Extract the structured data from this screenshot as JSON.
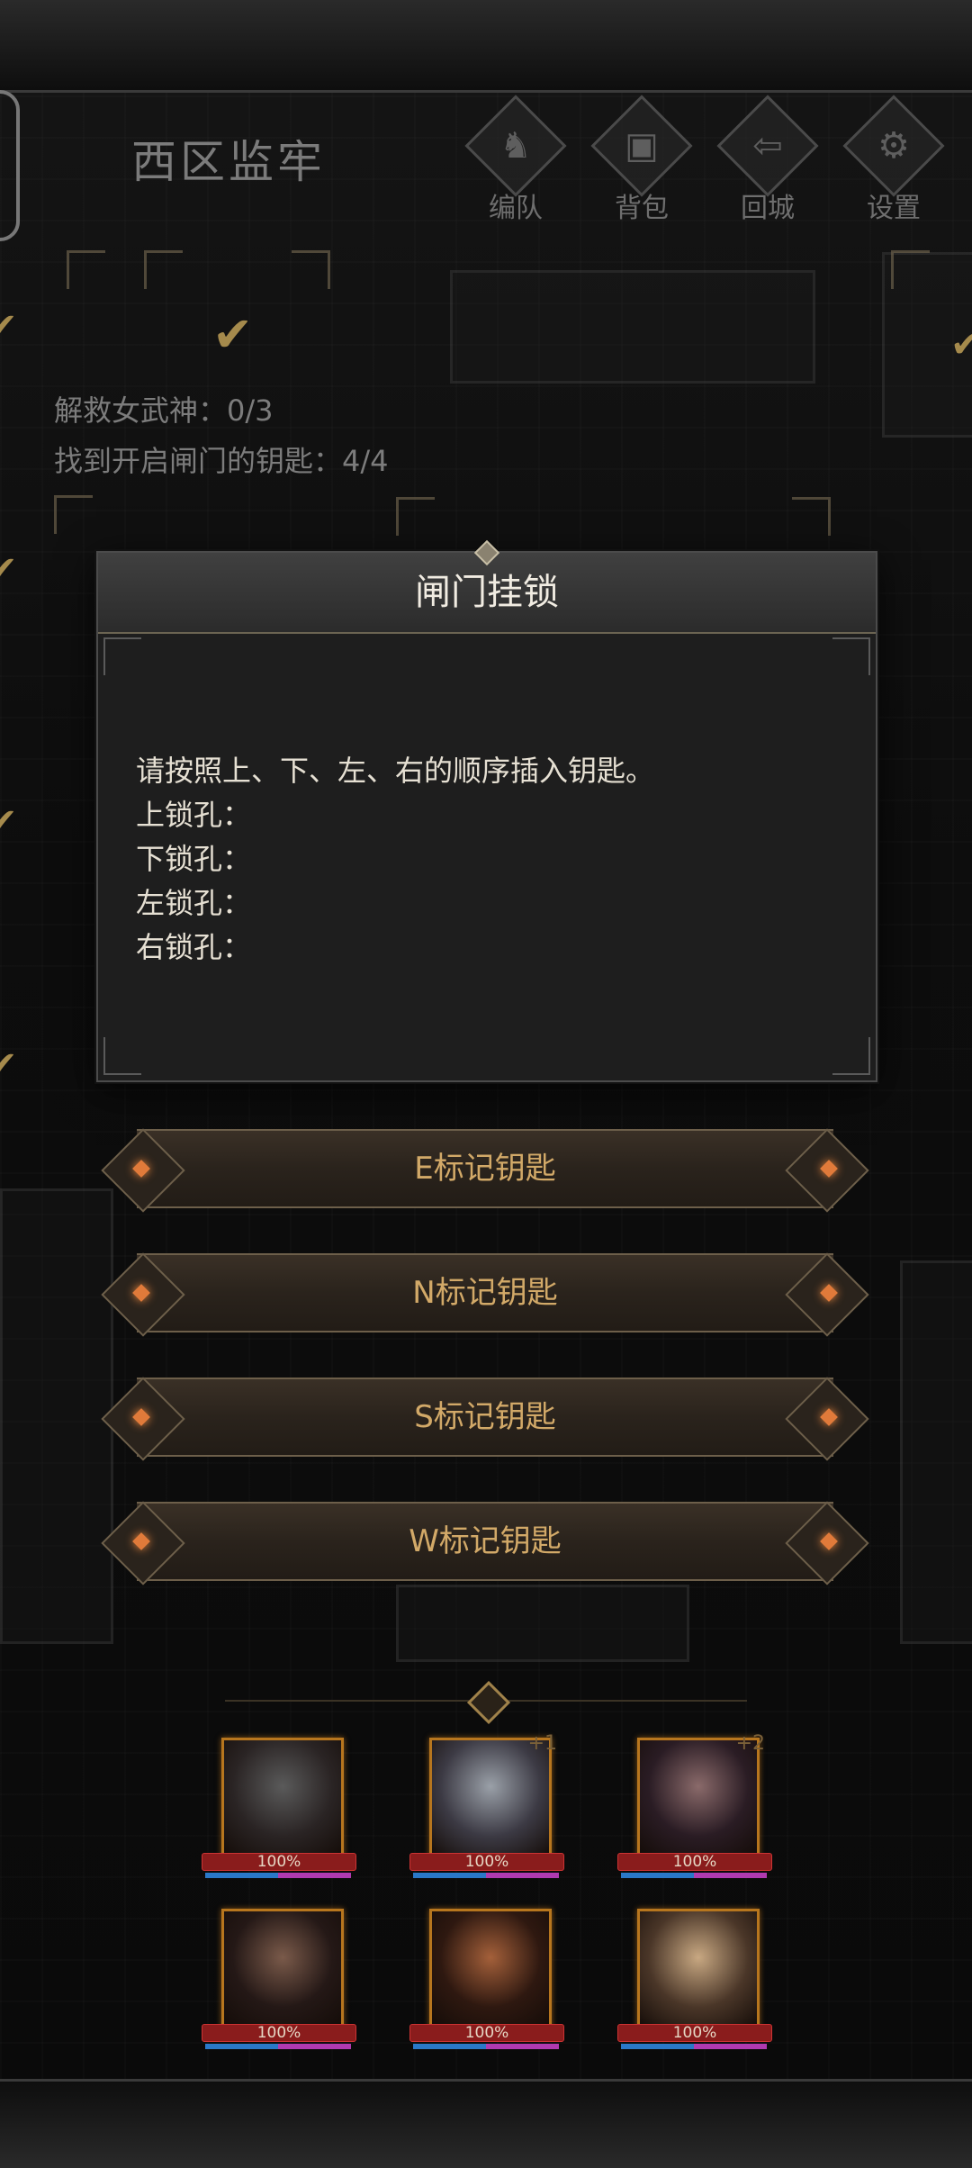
{
  "area": {
    "title": "西区监牢"
  },
  "menu": [
    {
      "label": "编队",
      "icon": "team-icon"
    },
    {
      "label": "背包",
      "icon": "bag-icon"
    },
    {
      "label": "回城",
      "icon": "return-icon"
    },
    {
      "label": "设置",
      "icon": "gear-icon"
    }
  ],
  "objectives": {
    "rescue": "解救女武神：0/3",
    "keys": "找到开启闸门的钥匙：4/4"
  },
  "modal": {
    "title": "闸门挂锁",
    "instruction": "请按照上、下、左、右的顺序插入钥匙。",
    "slots": [
      "上锁孔：",
      "下锁孔：",
      "左锁孔：",
      "右锁孔："
    ]
  },
  "keys": [
    "E标记钥匙",
    "N标记钥匙",
    "S标记钥匙",
    "W标记钥匙"
  ],
  "party": {
    "heroes": [
      {
        "hp": "100%",
        "level": ""
      },
      {
        "hp": "100%",
        "level": "+1"
      },
      {
        "hp": "100%",
        "level": "+2"
      },
      {
        "hp": "100%",
        "level": ""
      },
      {
        "hp": "100%",
        "level": ""
      },
      {
        "hp": "100%",
        "level": ""
      }
    ]
  },
  "colors": {
    "accent": "#d2a968",
    "frame": "#b7761e",
    "hp": "#8a1c1c"
  }
}
